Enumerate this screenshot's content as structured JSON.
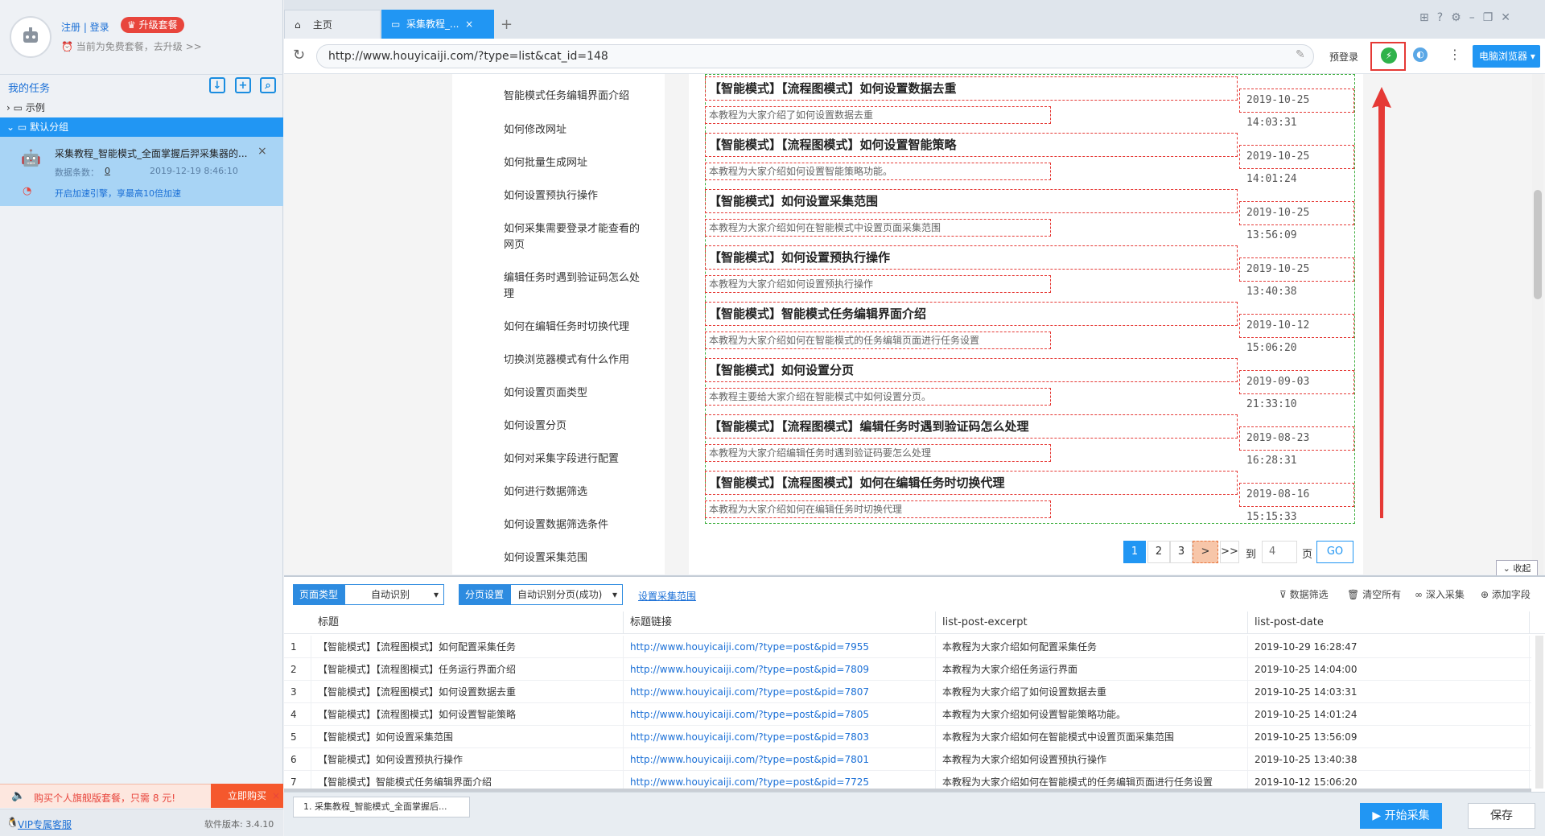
{
  "user": {
    "register_login": "注册 | 登录",
    "upgrade": "升级套餐",
    "plan_text": "当前为免费套餐，去升级 >>"
  },
  "tasks": {
    "header": "我的任务",
    "groups": [
      {
        "label": "示例",
        "expanded": false
      },
      {
        "label": "默认分组",
        "expanded": true
      }
    ],
    "task": {
      "name": "采集教程_智能模式_全面掌握后羿采集器的...",
      "count_label": "数据条数：",
      "count": "0",
      "time": "2019-12-19 8:46:10",
      "engine_tip": "开启加速引擎，享最高10倍加速"
    }
  },
  "promo": {
    "text": "购买个人旗舰版套餐，只需 8 元!",
    "buy": "立即购买"
  },
  "footer_left": {
    "vip": "VIP专属客服",
    "version": "软件版本: 3.4.10"
  },
  "tabs": [
    {
      "label": "主页"
    },
    {
      "label": "采集教程_..."
    }
  ],
  "address": {
    "url": "http://www.houyicaiji.com/?type=list&cat_id=148",
    "prelogin": "预登录",
    "browser": "电脑浏览器"
  },
  "web_sidebar": [
    "智能模式任务编辑界面介绍",
    "如何修改网址",
    "如何批量生成网址",
    "如何设置预执行操作",
    "如何采集需要登录才能查看的网页",
    "编辑任务时遇到验证码怎么处理",
    "如何在编辑任务时切换代理",
    "切换浏览器模式有什么作用",
    "如何设置页面类型",
    "如何设置分页",
    "如何对采集字段进行配置",
    "如何进行数据筛选",
    "如何设置数据筛选条件",
    "如何设置采集范围"
  ],
  "articles": [
    {
      "title": "【智能模式】【流程图模式】如何设置数据去重",
      "date": "2019-10-25 14:03:31",
      "excerpt": "本教程为大家介绍了如何设置数据去重"
    },
    {
      "title": "【智能模式】【流程图模式】如何设置智能策略",
      "date": "2019-10-25 14:01:24",
      "excerpt": "本教程为大家介绍如何设置智能策略功能。"
    },
    {
      "title": "【智能模式】如何设置采集范围",
      "date": "2019-10-25 13:56:09",
      "excerpt": "本教程为大家介绍如何在智能模式中设置页面采集范围"
    },
    {
      "title": "【智能模式】如何设置预执行操作",
      "date": "2019-10-25 13:40:38",
      "excerpt": "本教程为大家介绍如何设置预执行操作"
    },
    {
      "title": "【智能模式】智能模式任务编辑界面介绍",
      "date": "2019-10-12 15:06:20",
      "excerpt": "本教程为大家介绍如何在智能模式的任务编辑页面进行任务设置"
    },
    {
      "title": "【智能模式】如何设置分页",
      "date": "2019-09-03 21:33:10",
      "excerpt": "本教程主要给大家介绍在智能模式中如何设置分页。"
    },
    {
      "title": "【智能模式】【流程图模式】编辑任务时遇到验证码怎么处理",
      "date": "2019-08-23 16:28:31",
      "excerpt": "本教程为大家介绍编辑任务时遇到验证码要怎么处理"
    },
    {
      "title": "【智能模式】【流程图模式】如何在编辑任务时切换代理",
      "date": "2019-08-16 15:15:33",
      "excerpt": "本教程为大家介绍如何在编辑任务时切换代理"
    }
  ],
  "pagination": {
    "pages": [
      "1",
      "2",
      "3"
    ],
    "next": ">",
    "last": ">>",
    "to": "到",
    "page_input": "4",
    "page_unit": "页",
    "go": "GO"
  },
  "collapse": "收起",
  "config": {
    "page_type_label": "页面类型",
    "page_type_value": "自动识别",
    "paging_label": "分页设置",
    "paging_value": "自动识别分页(成功)",
    "range_link": "设置采集范围",
    "filter": "数据筛选",
    "clear": "清空所有",
    "deep": "深入采集",
    "add_field": "添加字段"
  },
  "table": {
    "headers": [
      "标题",
      "标题链接",
      "list-post-excerpt",
      "list-post-date"
    ],
    "rows": [
      [
        "1",
        "【智能模式】【流程图模式】如何配置采集任务",
        "http://www.houyicaiji.com/?type=post&pid=7955",
        "本教程为大家介绍如何配置采集任务",
        "2019-10-29 16:28:47"
      ],
      [
        "2",
        "【智能模式】【流程图模式】任务运行界面介绍",
        "http://www.houyicaiji.com/?type=post&pid=7809",
        "本教程为大家介绍任务运行界面",
        "2019-10-25 14:04:00"
      ],
      [
        "3",
        "【智能模式】【流程图模式】如何设置数据去重",
        "http://www.houyicaiji.com/?type=post&pid=7807",
        "本教程为大家介绍了如何设置数据去重",
        "2019-10-25 14:03:31"
      ],
      [
        "4",
        "【智能模式】【流程图模式】如何设置智能策略",
        "http://www.houyicaiji.com/?type=post&pid=7805",
        "本教程为大家介绍如何设置智能策略功能。",
        "2019-10-25 14:01:24"
      ],
      [
        "5",
        "【智能模式】如何设置采集范围",
        "http://www.houyicaiji.com/?type=post&pid=7803",
        "本教程为大家介绍如何在智能模式中设置页面采集范围",
        "2019-10-25 13:56:09"
      ],
      [
        "6",
        "【智能模式】如何设置预执行操作",
        "http://www.houyicaiji.com/?type=post&pid=7801",
        "本教程为大家介绍如何设置预执行操作",
        "2019-10-25 13:40:38"
      ],
      [
        "7",
        "【智能模式】智能模式任务编辑界面介绍",
        "http://www.houyicaiji.com/?type=post&pid=7725",
        "本教程为大家介绍如何在智能模式的任务编辑页面进行任务设置",
        "2019-10-12 15:06:20"
      ]
    ]
  },
  "bottom": {
    "task_tab": "1. 采集教程_智能模式_全面掌握后...",
    "start": "开始采集",
    "save": "保存"
  },
  "colors": {
    "accent": "#2196f3",
    "red": "#e53935",
    "green_dash": "#3cae3c"
  }
}
